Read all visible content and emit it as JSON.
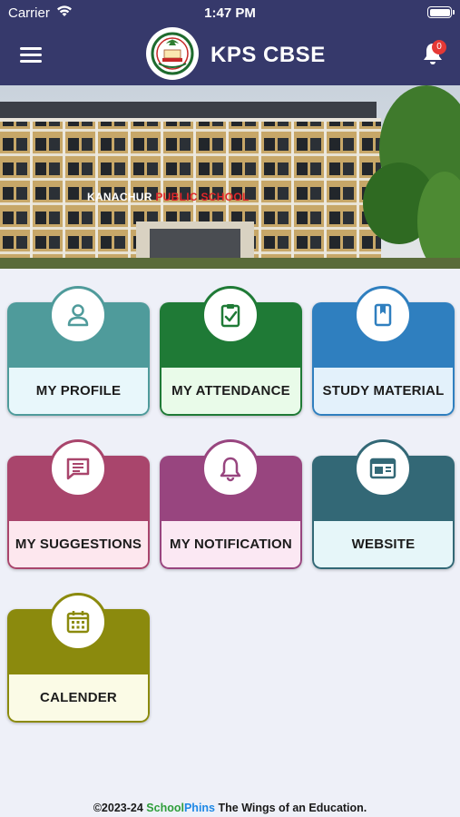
{
  "status_bar": {
    "carrier": "Carrier",
    "time": "1:47 PM"
  },
  "header": {
    "title": "KPS CBSE",
    "notification_count": "0"
  },
  "banner": {
    "school_name_part1": "KANACHUR",
    "school_name_part2": "PUBLIC SCHOOL"
  },
  "tiles": [
    {
      "label": "MY PROFILE",
      "icon": "person-icon",
      "color": "#4f9b9b",
      "light": "#e8f7fb"
    },
    {
      "label": "MY ATTENDANCE",
      "icon": "clipboard-check-icon",
      "color": "#1f7a36",
      "light": "#e9fbe9"
    },
    {
      "label": "STUDY MATERIAL",
      "icon": "book-icon",
      "color": "#2f7fbf",
      "light": "#e3f1fb"
    },
    {
      "label": "MY SUGGESTIONS",
      "icon": "chat-icon",
      "color": "#a9456c",
      "light": "#fde7ee"
    },
    {
      "label": "MY NOTIFICATION",
      "icon": "bell-icon",
      "color": "#98457f",
      "light": "#fbe8f3"
    },
    {
      "label": "WEBSITE",
      "icon": "browser-icon",
      "color": "#336876",
      "light": "#e6f6f9"
    },
    {
      "label": "CALENDER",
      "icon": "calendar-icon",
      "color": "#8b8a0d",
      "light": "#fbfbe6"
    }
  ],
  "footer": {
    "copyright": "©2023-24",
    "brand_part1": "School",
    "brand_part2": "Phins",
    "tagline": "The Wings of an Education."
  }
}
